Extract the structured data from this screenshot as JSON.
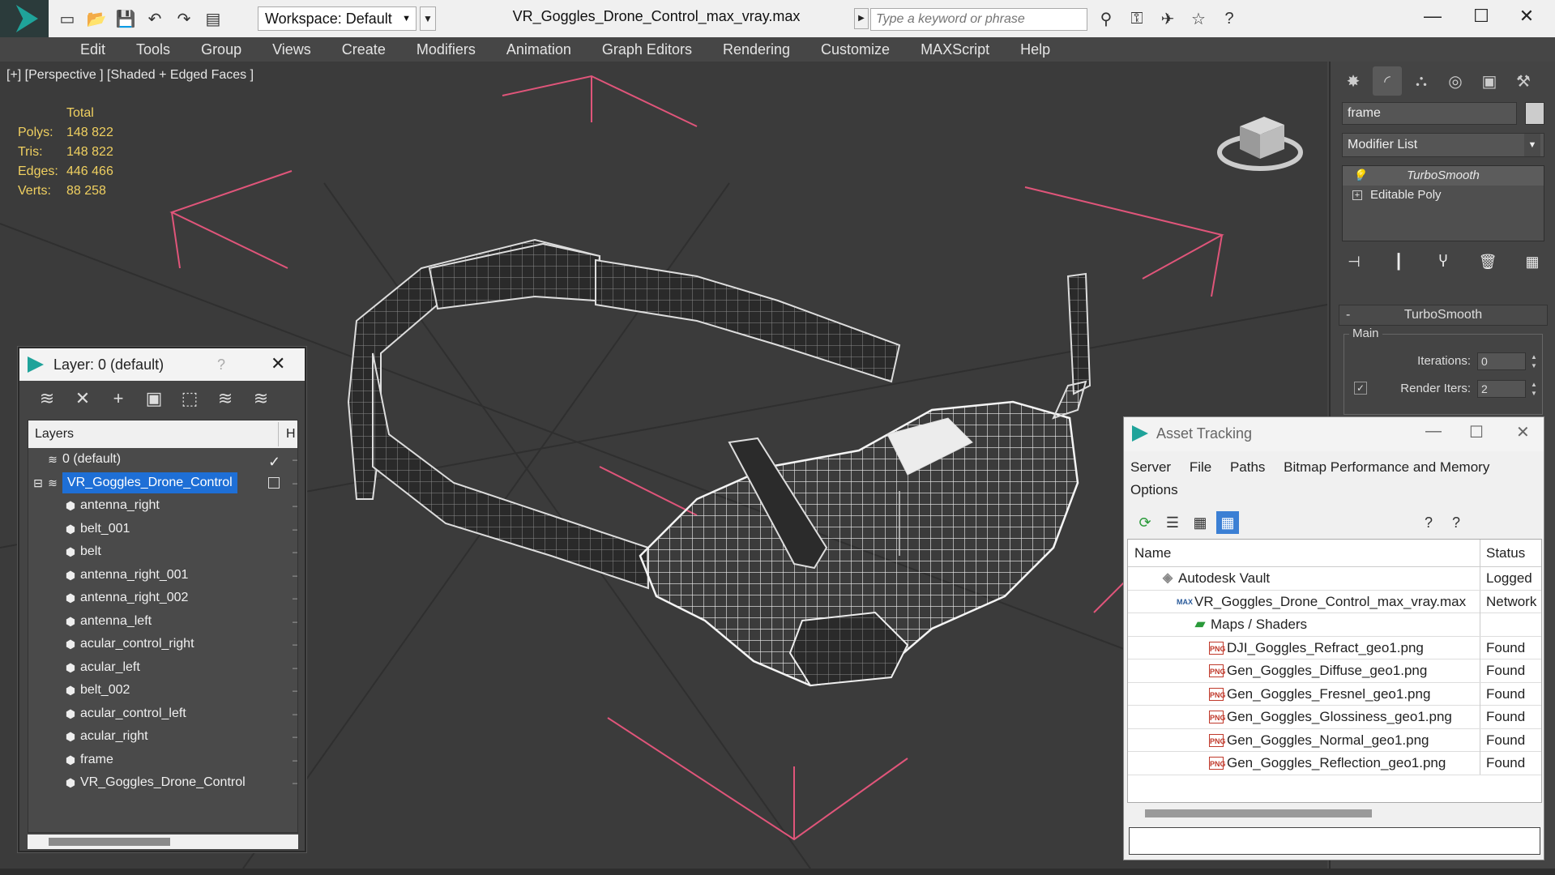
{
  "titlebar": {
    "workspace": "Workspace: Default",
    "window_title": "VR_Goggles_Drone_Control_max_vray.max",
    "search_placeholder": "Type a keyword or phrase"
  },
  "menu": [
    "Edit",
    "Tools",
    "Group",
    "Views",
    "Create",
    "Modifiers",
    "Animation",
    "Graph Editors",
    "Rendering",
    "Customize",
    "MAXScript",
    "Help"
  ],
  "viewport": {
    "label": "[+] [Perspective ] [Shaded + Edged Faces ]",
    "stats_header": "Total",
    "stats": [
      {
        "label": "Polys:",
        "value": "148 822"
      },
      {
        "label": "Tris:",
        "value": "148 822"
      },
      {
        "label": "Edges:",
        "value": "446 466"
      },
      {
        "label": "Verts:",
        "value": "88 258"
      }
    ]
  },
  "command_panel": {
    "object_name": "frame",
    "modifier_list": "Modifier List",
    "stack": [
      "TurboSmooth",
      "Editable Poly"
    ],
    "rollout_title": "TurboSmooth",
    "group_title": "Main",
    "iterations_label": "Iterations:",
    "iterations_value": "0",
    "render_iters_label": "Render Iters:",
    "render_iters_value": "2"
  },
  "layer_dialog": {
    "title": "Layer: 0 (default)",
    "help": "?",
    "col_layers": "Layers",
    "col_h": "H",
    "rows": [
      {
        "name": "0 (default)",
        "level": 0
      },
      {
        "name": "VR_Goggles_Drone_Control",
        "level": 0
      },
      {
        "name": "antenna_right",
        "level": 1
      },
      {
        "name": "belt_001",
        "level": 1
      },
      {
        "name": "belt",
        "level": 1
      },
      {
        "name": "antenna_right_001",
        "level": 1
      },
      {
        "name": "antenna_right_002",
        "level": 1
      },
      {
        "name": "antenna_left",
        "level": 1
      },
      {
        "name": "acular_control_right",
        "level": 1
      },
      {
        "name": "acular_left",
        "level": 1
      },
      {
        "name": "belt_002",
        "level": 1
      },
      {
        "name": "acular_control_left",
        "level": 1
      },
      {
        "name": "acular_right",
        "level": 1
      },
      {
        "name": "frame",
        "level": 1
      },
      {
        "name": "VR_Goggles_Drone_Control",
        "level": 1
      }
    ]
  },
  "asset_tracking": {
    "title": "Asset Tracking",
    "menu": [
      "Server",
      "File",
      "Paths",
      "Bitmap Performance and Memory",
      "Options"
    ],
    "col_name": "Name",
    "col_status": "Status",
    "rows": [
      {
        "name": "Autodesk Vault",
        "status": "Logged",
        "icon": "vault-icon"
      },
      {
        "name": "VR_Goggles_Drone_Control_max_vray.max",
        "status": "Network",
        "icon": "max-file-icon"
      },
      {
        "name": "Maps / Shaders",
        "status": "",
        "icon": "maps-icon"
      },
      {
        "name": "DJI_Goggles_Refract_geo1.png",
        "status": "Found",
        "icon": "png-icon"
      },
      {
        "name": "Gen_Goggles_Diffuse_geo1.png",
        "status": "Found",
        "icon": "png-icon"
      },
      {
        "name": "Gen_Goggles_Fresnel_geo1.png",
        "status": "Found",
        "icon": "png-icon"
      },
      {
        "name": "Gen_Goggles_Glossiness_geo1.png",
        "status": "Found",
        "icon": "png-icon"
      },
      {
        "name": "Gen_Goggles_Normal_geo1.png",
        "status": "Found",
        "icon": "png-icon"
      },
      {
        "name": "Gen_Goggles_Reflection_geo1.png",
        "status": "Found",
        "icon": "png-icon"
      }
    ]
  },
  "colors": {
    "accent": "#1e6fd6",
    "stats_text": "#f0d060",
    "wire": "#ffffff",
    "bbox_lines": "#e0557a"
  }
}
